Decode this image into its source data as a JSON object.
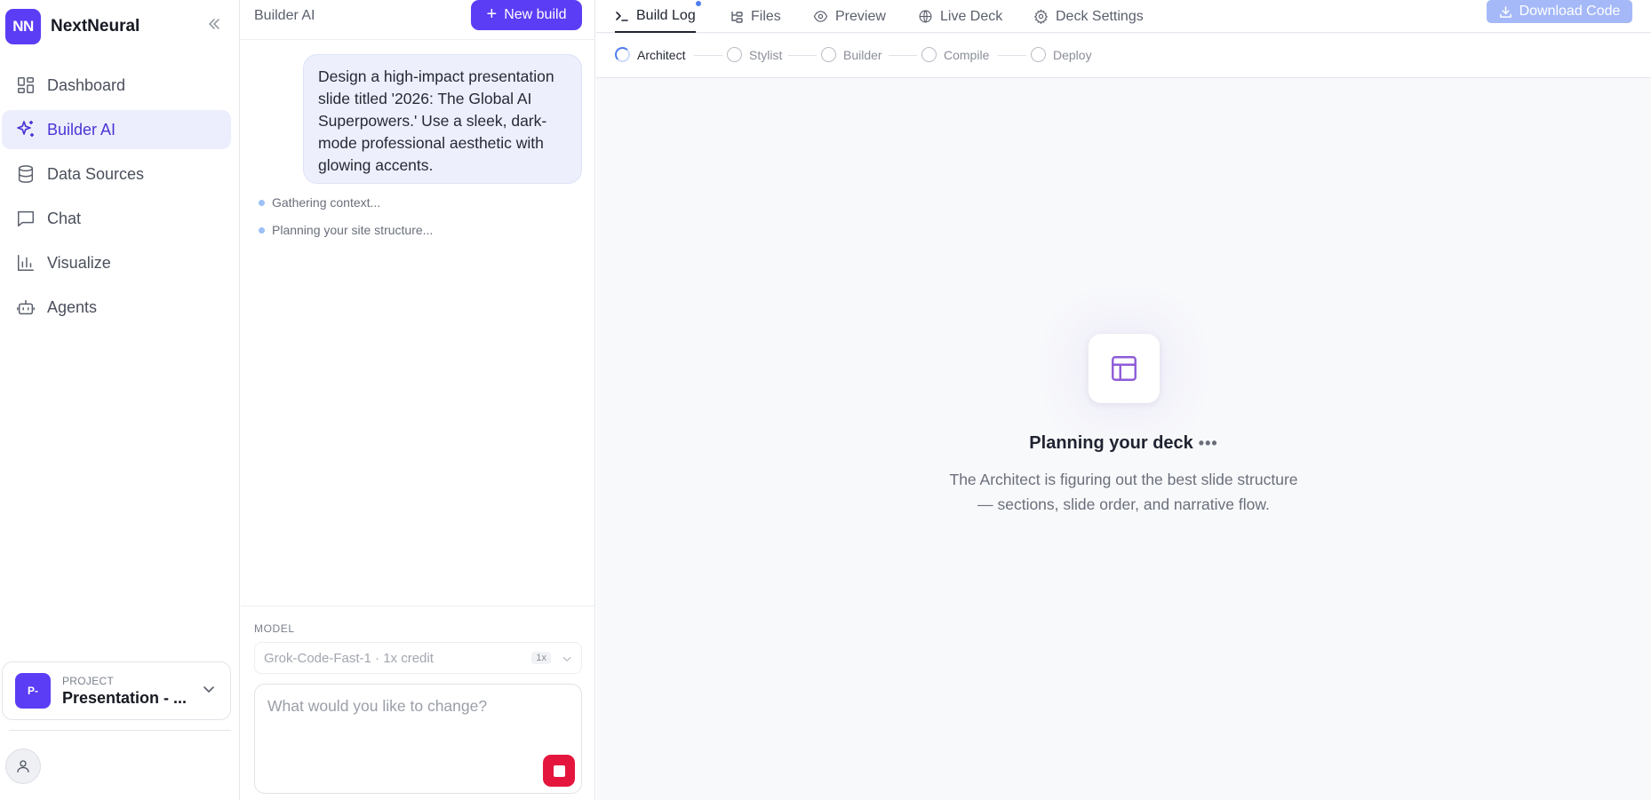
{
  "brand": {
    "logo_text": "NN",
    "name": "NextNeural"
  },
  "sidebar": {
    "items": [
      {
        "label": "Dashboard",
        "icon": "dashboard-icon"
      },
      {
        "label": "Builder AI",
        "icon": "sparkle-icon",
        "active": true
      },
      {
        "label": "Data Sources",
        "icon": "database-icon"
      },
      {
        "label": "Chat",
        "icon": "chat-icon"
      },
      {
        "label": "Visualize",
        "icon": "bar-chart-icon"
      },
      {
        "label": "Agents",
        "icon": "bot-icon"
      }
    ],
    "project": {
      "badge": "P-",
      "label": "PROJECT",
      "name": "Presentation - ..."
    }
  },
  "chat": {
    "title": "Builder AI",
    "new_build_label": "New build",
    "user_message": "Design a high-impact presentation slide titled '2026: The Global AI Superpowers.' Use a sleek, dark-mode professional aesthetic with glowing accents.",
    "steps": [
      "Gathering context...",
      "Planning your site structure..."
    ],
    "model_label": "MODEL",
    "model_value": "Grok-Code-Fast-1 · 1x credit",
    "model_badge": "1x",
    "prompt_placeholder": "What would you like to change?"
  },
  "tabs": {
    "build_log": "Build Log",
    "files": "Files",
    "preview": "Preview",
    "live_deck": "Live Deck",
    "deck_settings": "Deck Settings",
    "download": "Download Code"
  },
  "pipeline": [
    "Architect",
    "Stylist",
    "Builder",
    "Compile",
    "Deploy"
  ],
  "status": {
    "title": "Planning your deck",
    "dots": "•••",
    "desc_line1": "The Architect is figuring out the best slide structure",
    "desc_line2": "— sections, slide order, and narrative flow."
  },
  "colors": {
    "accent": "#5b3df5",
    "active_bg": "#eceefd",
    "stop": "#e4163d",
    "download_disabled": "#a5b8f8",
    "progress": "#4e7cf0"
  }
}
